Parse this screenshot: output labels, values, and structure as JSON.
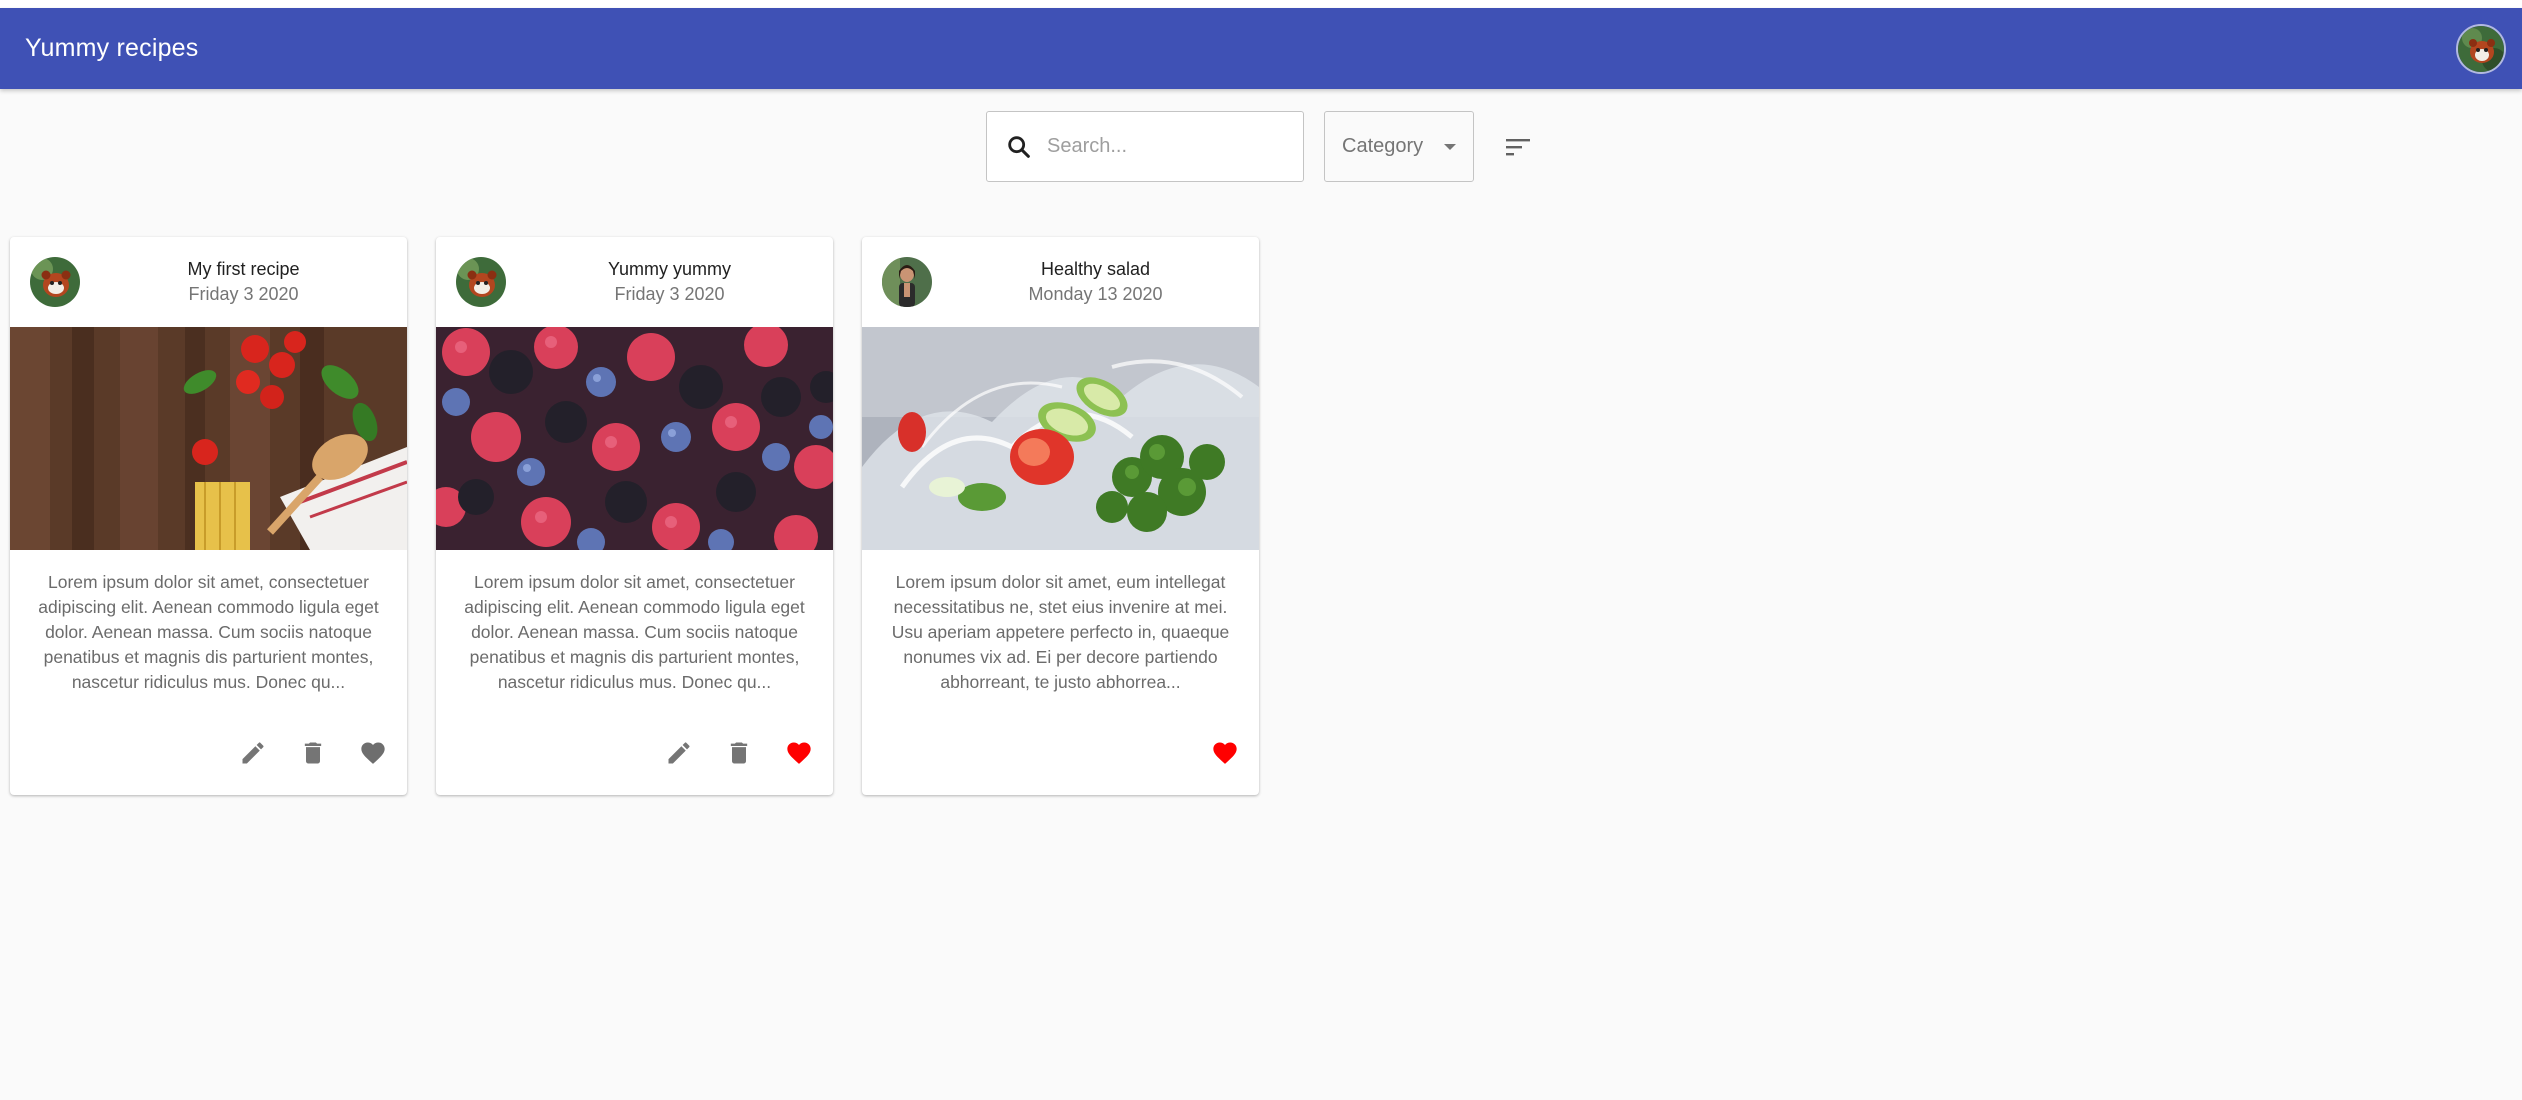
{
  "app": {
    "title": "Yummy recipes"
  },
  "search": {
    "placeholder": "Search...",
    "value": ""
  },
  "category": {
    "label": "Category"
  },
  "colors": {
    "appbar": "#3f51b5",
    "favorite_active": "#ff0000",
    "favorite_inactive": "#6e6e6e",
    "action_icon": "#757575"
  },
  "icons": {
    "search": "search-icon",
    "sort": "sort-icon",
    "dropdown": "chevron-down-icon",
    "edit": "pencil-icon",
    "delete": "trash-icon",
    "favorite": "heart-icon"
  },
  "recipes": [
    {
      "title": "My first recipe",
      "date": "Friday 3 2020",
      "description": "Lorem ipsum dolor sit amet, consectetuer adipiscing elit. Aenean commodo ligula eget dolor. Aenean massa. Cum sociis natoque penatibus et magnis dis parturient montes, nascetur ridiculus mus. Donec qu...",
      "favorite": false,
      "editable": true
    },
    {
      "title": "Yummy yummy",
      "date": "Friday 3 2020",
      "description": "Lorem ipsum dolor sit amet, consectetuer adipiscing elit. Aenean commodo ligula eget dolor. Aenean massa. Cum sociis natoque penatibus et magnis dis parturient montes, nascetur ridiculus mus. Donec qu...",
      "favorite": true,
      "editable": true
    },
    {
      "title": "Healthy salad",
      "date": "Monday 13 2020",
      "description": "Lorem ipsum dolor sit amet, eum intellegat necessitatibus ne, stet eius invenire at mei. Usu aperiam appetere perfecto in, quaeque nonumes vix ad. Ei per decore partiendo abhorreant, te justo abhorrea...",
      "favorite": true,
      "editable": false
    }
  ]
}
